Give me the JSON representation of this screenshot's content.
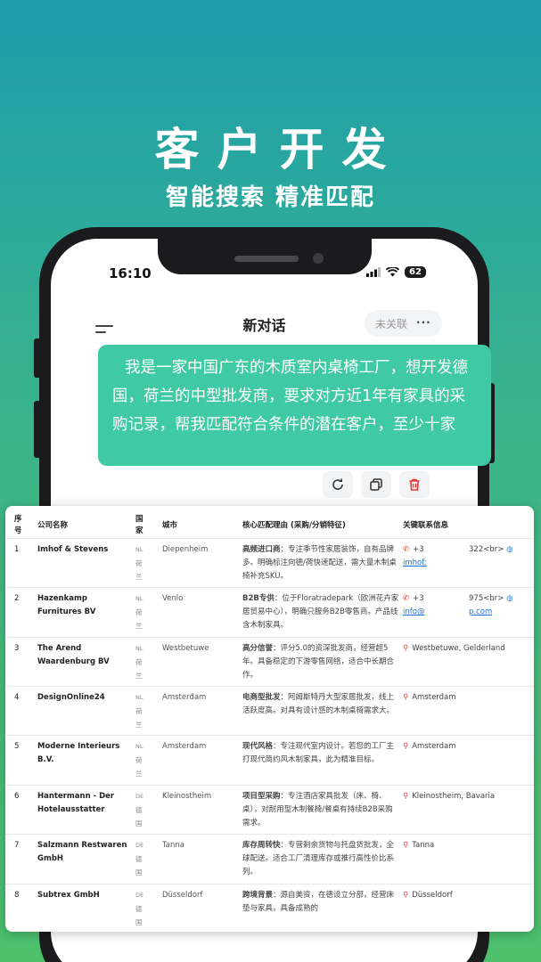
{
  "hero": {
    "title": "客户开发",
    "subtitle": "智能搜索 精准匹配"
  },
  "status": {
    "time": "16:10",
    "battery": "62"
  },
  "chat": {
    "title": "新对话",
    "link_status": "未关联",
    "more": "···",
    "message": "我是一家中国广东的木质室内桌椅工厂，想开发德国，荷兰的中型批发商，要求对方近1年有家具的采购记录，帮我匹配符合条件的潜在客户，至少十家"
  },
  "table": {
    "headers": {
      "no": "序号",
      "company": "公司名称",
      "country": "国家",
      "city": "城市",
      "reason": "核心匹配理由 (采购/分销特征)",
      "contact": "关键联系信息"
    },
    "rows": [
      {
        "no": "1",
        "company": "Imhof & Stevens",
        "country_code": "NL",
        "country": "荷兰",
        "city": "Diepenheim",
        "reason_tag": "高频进口商",
        "reason_text": "：专注季节性家居装饰，自有品牌多。明确标注向德/荷快速配送，需大量木制桌椅补充SKU。",
        "contact_icon": "phone-icon",
        "contact": "+3",
        "contact_link": "imhof:",
        "contact_extra": "322<br>"
      },
      {
        "no": "2",
        "company": "Hazenkamp Furnitures BV",
        "country_code": "NL",
        "country": "荷兰",
        "city": "Venlo",
        "reason_tag": "B2B专供",
        "reason_text": "：位于Floratradepark（欧洲花卉家居贸易中心），明确只服务B2B零售商。产品线含木制家具。",
        "contact_icon": "phone-icon",
        "contact": "+3",
        "contact_link": "info@",
        "contact_extra": "975<br>",
        "contact_extra_link": "p.com"
      },
      {
        "no": "3",
        "company": "The Arend Waardenburg BV",
        "country_code": "NL",
        "country": "荷兰",
        "city": "Westbetuwe",
        "reason_tag": "高分信誉",
        "reason_text": "：评分5.0的资深批发商，经营超5年。具备稳定的下游零售网络，适合中长期合作。",
        "contact_icon": "pin-icon",
        "contact": "Westbetuwe, Gelderland"
      },
      {
        "no": "4",
        "company": "DesignOnline24",
        "country_code": "NL",
        "country": "荷兰",
        "city": "Amsterdam",
        "reason_tag": "电商型批发",
        "reason_text": "：阿姆斯特丹大型家居批发，线上活跃度高。对具有设计感的木制桌椅需求大。",
        "contact_icon": "pin-icon",
        "contact": "Amsterdam"
      },
      {
        "no": "5",
        "company": "Moderne Interieurs B.V.",
        "country_code": "NL",
        "country": "荷兰",
        "city": "Amsterdam",
        "reason_tag": "现代风格",
        "reason_text": "：专注现代室内设计。若您的工厂主打现代简约风木制家具，此为精准目标。",
        "contact_icon": "pin-icon",
        "contact": "Amsterdam"
      },
      {
        "no": "6",
        "company": "Hantermann - Der Hotelausstatter",
        "country_code": "DE",
        "country": "德国",
        "city": "Kleinostheim",
        "reason_tag": "项目型采购",
        "reason_text": "：专注酒店家具批发（床、椅、桌），对耐用型木制餐椅/餐桌有持续B2B采购需求。",
        "contact_icon": "pin-icon",
        "contact": "Kleinostheim, Bavaria"
      },
      {
        "no": "7",
        "company": "Salzmann Restwaren GmbH",
        "country_code": "DE",
        "country": "德国",
        "city": "Tanna",
        "reason_tag": "库存周转快",
        "reason_text": "：专营剩余货物与托盘货批发，全球配送。适合工厂清理库存或推行高性价比系列。",
        "contact_icon": "pin-icon",
        "contact": "Tanna"
      },
      {
        "no": "8",
        "company": "Subtrex GmbH",
        "country_code": "DE",
        "country": "德国",
        "city": "Düsseldorf",
        "reason_tag": "跨境背景",
        "reason_text": "：源自美资，在德设立分部，经营床垫与家具，具备成熟的",
        "contact_icon": "pin-icon",
        "contact": "Düsseldorf"
      }
    ]
  },
  "colors": {
    "accent": "#40c9a5",
    "phone": "#1b1b1d",
    "link": "#1e6fd9",
    "icon_red": "#e53935"
  }
}
